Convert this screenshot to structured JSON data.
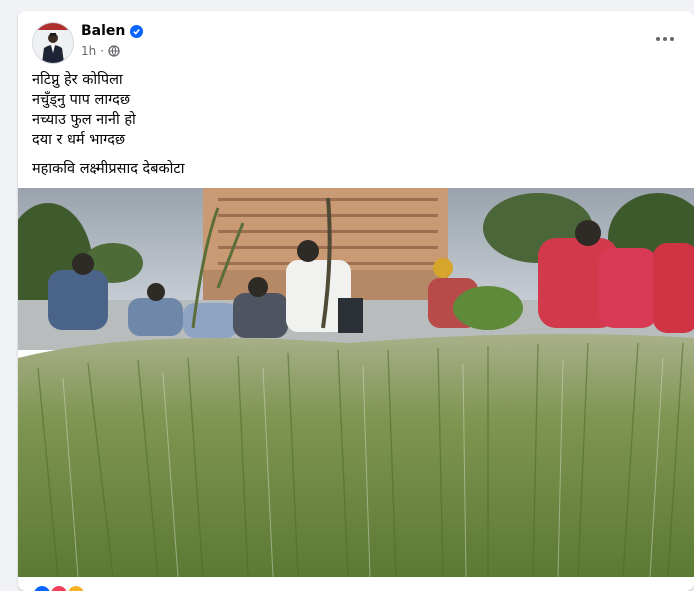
{
  "post": {
    "author": "Balen",
    "time": "1h",
    "poem": [
      "नटिप्नु हेर कोपिला",
      "नचुँड्नु पाप लाग्दछ",
      "नच्याउ फुल नानी हो",
      "दया र धर्म भाग्दछ"
    ],
    "poet": "महाकवि लक्ष्मीप्रसाद देबकोटा",
    "footer_fragment": "... ... ... ..."
  },
  "icons": {
    "verified": "verified-badge-icon",
    "audience": "globe-icon",
    "more": "more-options-icon"
  },
  "colors": {
    "verified": "#0866ff",
    "like": "#0866ff",
    "love": "#f33e58",
    "care": "#f7b125"
  }
}
